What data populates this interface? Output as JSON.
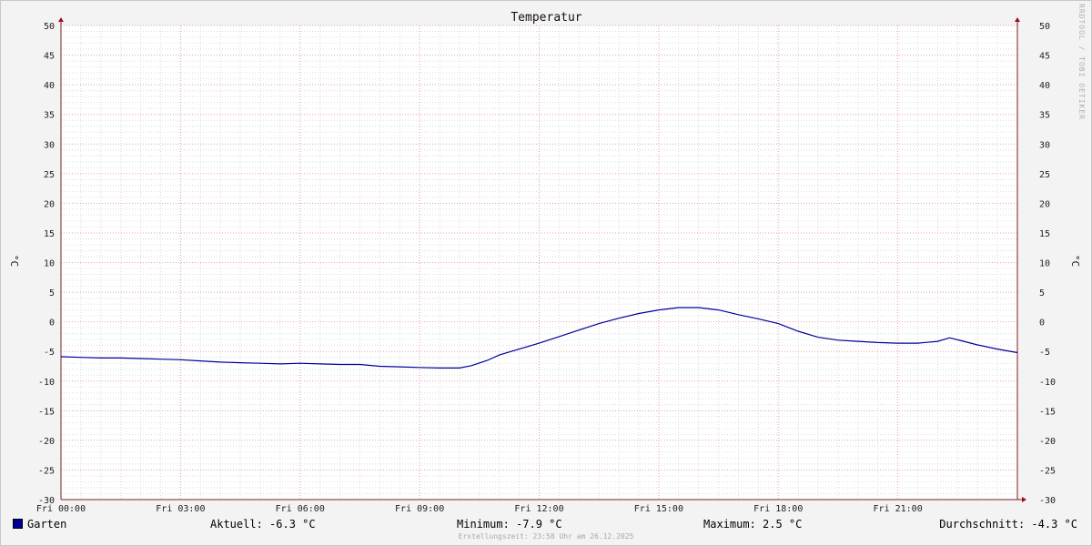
{
  "chart_data": {
    "type": "line",
    "title": "Temperatur",
    "ylabel_left": "°C",
    "ylabel_right": "°C",
    "ylim": [
      -30,
      50
    ],
    "y_ticks": [
      50,
      45,
      40,
      35,
      30,
      25,
      20,
      15,
      10,
      5,
      0,
      -5,
      -10,
      -15,
      -20,
      -25,
      -30
    ],
    "xlim_hours": [
      0,
      24
    ],
    "x_ticks": [
      {
        "hour": 0,
        "label": "Fri 00:00"
      },
      {
        "hour": 3,
        "label": "Fri 03:00"
      },
      {
        "hour": 6,
        "label": "Fri 06:00"
      },
      {
        "hour": 9,
        "label": "Fri 09:00"
      },
      {
        "hour": 12,
        "label": "Fri 12:00"
      },
      {
        "hour": 15,
        "label": "Fri 15:00"
      },
      {
        "hour": 18,
        "label": "Fri 18:00"
      },
      {
        "hour": 21,
        "label": "Fri 21:00"
      }
    ],
    "grid": true,
    "series": [
      {
        "name": "Garten",
        "color": "#000099",
        "points": [
          [
            0.0,
            -5.9
          ],
          [
            0.5,
            -6.0
          ],
          [
            1.0,
            -6.1
          ],
          [
            1.5,
            -6.1
          ],
          [
            2.0,
            -6.2
          ],
          [
            2.5,
            -6.3
          ],
          [
            3.0,
            -6.4
          ],
          [
            3.5,
            -6.6
          ],
          [
            4.0,
            -6.8
          ],
          [
            4.5,
            -6.9
          ],
          [
            5.0,
            -7.0
          ],
          [
            5.5,
            -7.1
          ],
          [
            6.0,
            -7.0
          ],
          [
            6.5,
            -7.1
          ],
          [
            7.0,
            -7.2
          ],
          [
            7.5,
            -7.2
          ],
          [
            8.0,
            -7.5
          ],
          [
            8.5,
            -7.6
          ],
          [
            9.0,
            -7.7
          ],
          [
            9.5,
            -7.8
          ],
          [
            10.0,
            -7.8
          ],
          [
            10.3,
            -7.4
          ],
          [
            10.7,
            -6.5
          ],
          [
            11.0,
            -5.6
          ],
          [
            11.5,
            -4.6
          ],
          [
            12.0,
            -3.6
          ],
          [
            12.5,
            -2.5
          ],
          [
            13.0,
            -1.4
          ],
          [
            13.5,
            -0.3
          ],
          [
            14.0,
            0.6
          ],
          [
            14.5,
            1.4
          ],
          [
            15.0,
            2.0
          ],
          [
            15.5,
            2.4
          ],
          [
            16.0,
            2.4
          ],
          [
            16.5,
            2.0
          ],
          [
            17.0,
            1.2
          ],
          [
            17.5,
            0.5
          ],
          [
            18.0,
            -0.3
          ],
          [
            18.5,
            -1.6
          ],
          [
            19.0,
            -2.6
          ],
          [
            19.5,
            -3.1
          ],
          [
            20.0,
            -3.3
          ],
          [
            20.5,
            -3.5
          ],
          [
            21.0,
            -3.6
          ],
          [
            21.5,
            -3.6
          ],
          [
            22.0,
            -3.3
          ],
          [
            22.3,
            -2.7
          ],
          [
            22.6,
            -3.2
          ],
          [
            23.0,
            -3.9
          ],
          [
            23.5,
            -4.6
          ],
          [
            24.0,
            -5.2
          ]
        ]
      }
    ]
  },
  "legend": {
    "name": "Garten",
    "current": "Aktuell: -6.3 °C",
    "minimum": "Minimum: -7.9 °C",
    "maximum": "Maximum: 2.5 °C",
    "average": "Durchschnitt: -4.3 °C"
  },
  "footer": "Erstellungszeit: 23:58 Uhr am 26.12.2025",
  "watermark": "RRDTOOL / TOBI OETIKER"
}
